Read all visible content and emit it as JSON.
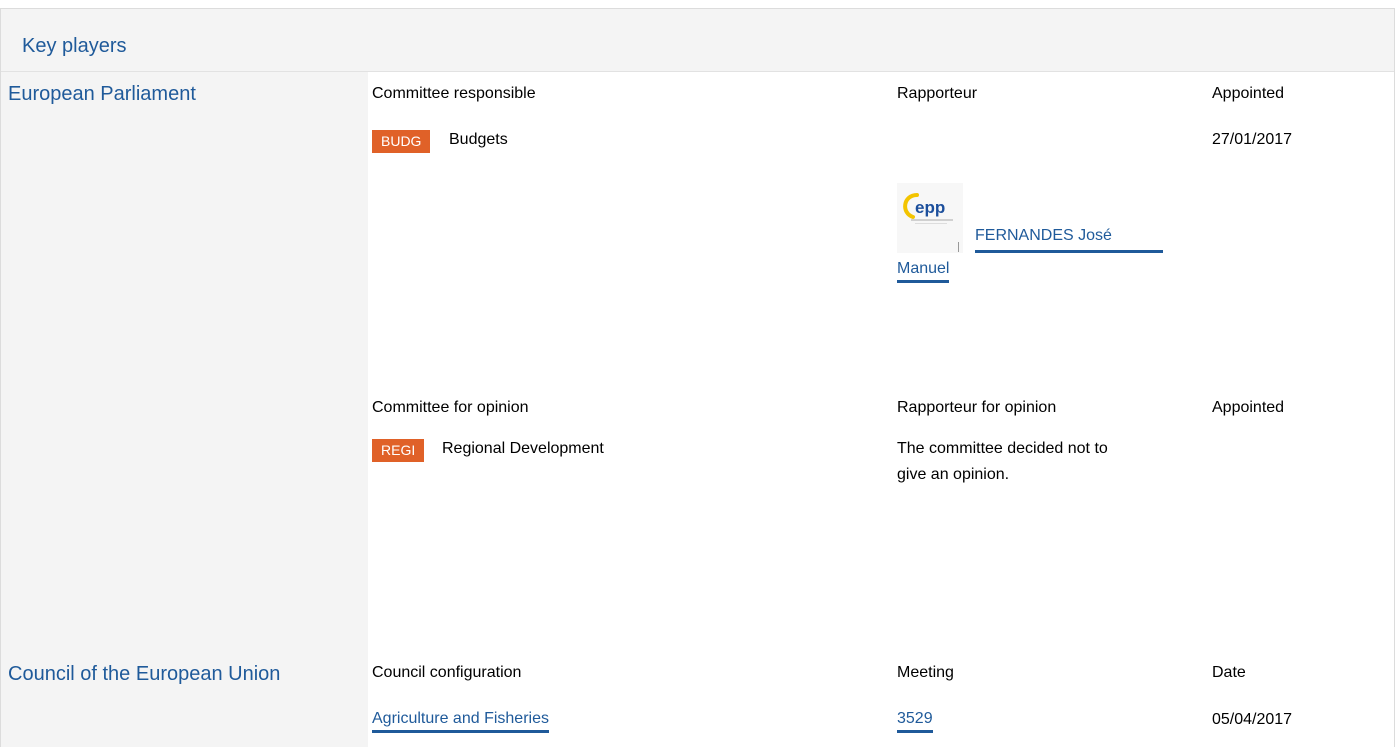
{
  "header": {
    "title": "Key players"
  },
  "parliament": {
    "label": "European Parliament",
    "responsible": {
      "col_committee": "Committee responsible",
      "col_rapporteur": "Rapporteur",
      "col_appointed": "Appointed",
      "committee_code": "BUDG",
      "committee_name": "Budgets",
      "appointed_date": "27/01/2017",
      "rapporteur_group": "epp",
      "rapporteur_name_line1": "FERNANDES José",
      "rapporteur_name_line2": "Manuel"
    },
    "opinion": {
      "col_committee": "Committee for opinion",
      "col_rapporteur": "Rapporteur for opinion",
      "col_appointed": "Appointed",
      "committee_code": "REGI",
      "committee_name": "Regional Development",
      "note_line1": "The committee decided not to",
      "note_line2": "give an opinion."
    }
  },
  "council": {
    "label": "Council of the European Union",
    "col_configuration": "Council configuration",
    "col_meeting": "Meeting",
    "col_date": "Date",
    "configuration": "Agriculture and Fisheries",
    "meeting": "3529",
    "date": "05/04/2017"
  },
  "colors": {
    "accent": "#1f5a9a",
    "badge": "#e06128",
    "panel": "#f4f4f4",
    "epp_yellow": "#f3c400",
    "epp_blue": "#1c4f9c"
  }
}
